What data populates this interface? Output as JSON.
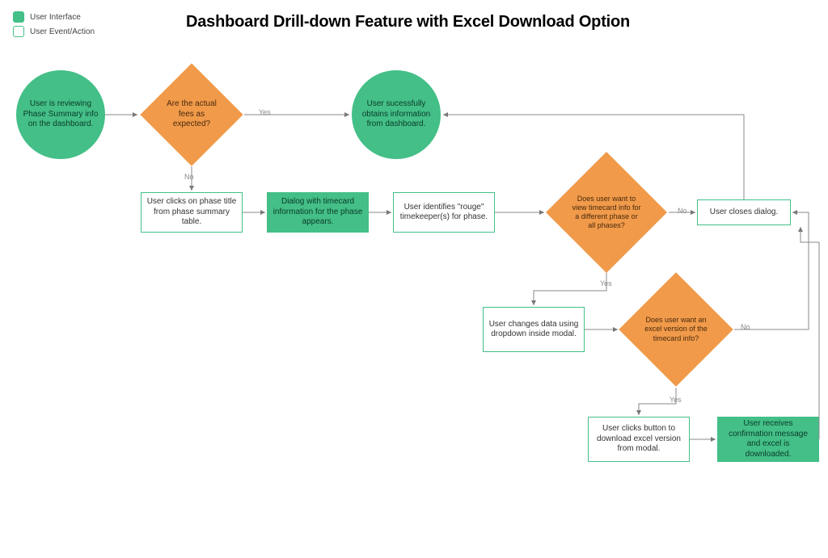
{
  "title": "Dashboard Drill-down Feature with Excel Download Option",
  "legend": {
    "ui_label": "User Interface",
    "event_label": "User Event/Action"
  },
  "nodes": {
    "start": "User is reviewing Phase Summary info on the dashboard.",
    "q_fees": "Are the actual fees as expected?",
    "success": "User sucessfully obtains information from dashboard.",
    "click_title": "User clicks on phase title from phase summary table.",
    "dialog": "Dialog with timecard information for the phase appears.",
    "identify": "User identifies \"rouge\" timekeeper(s) for phase.",
    "q_otherphase": "Does user want to view timecard info for a different phase or all phases?",
    "close_dialog": "User closes dialog.",
    "change_data": "User changes data using dropdown inside modal.",
    "q_excel": "Does user want an excel version of the timecard info?",
    "download_click": "User clicks button to download excel version from modal.",
    "confirm": "User receives confirmation message and excel is downloaded."
  },
  "edge_labels": {
    "yes1": "Yes",
    "no1": "No",
    "yes2": "Yes",
    "no2": "No",
    "yes3": "Yes",
    "no3": "No"
  },
  "colors": {
    "green": "#43bf87",
    "orange": "#f09a4a"
  }
}
